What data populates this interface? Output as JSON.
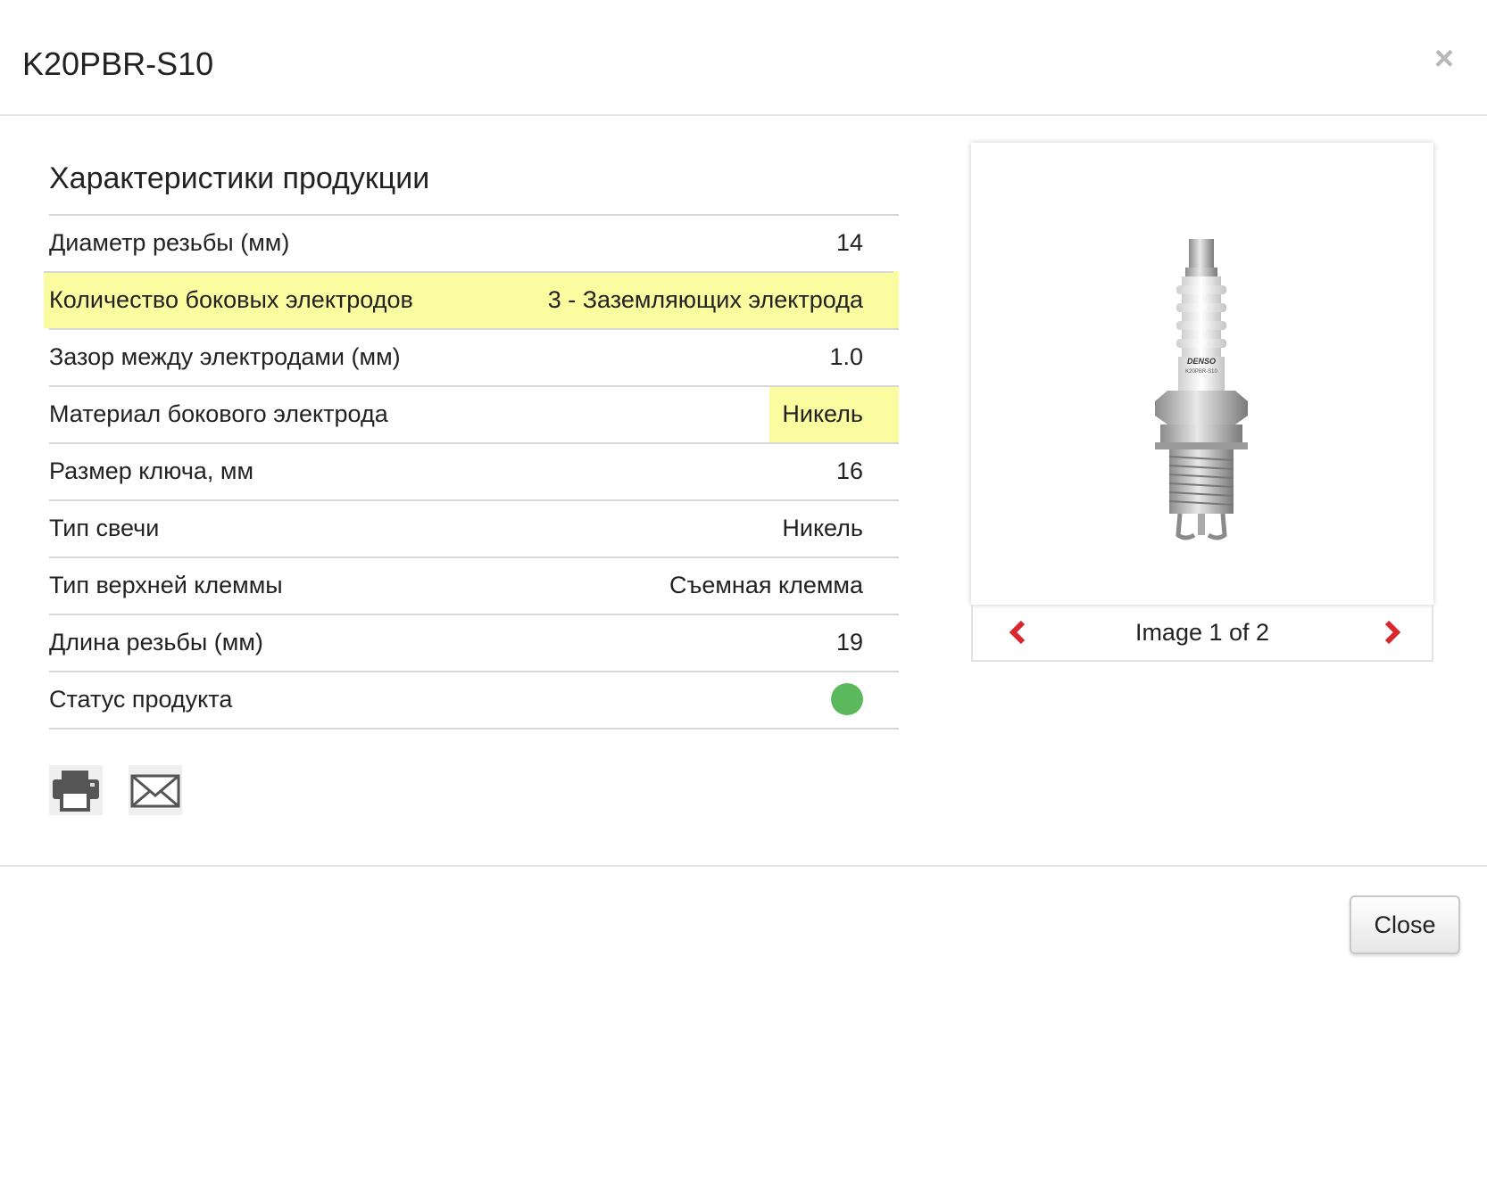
{
  "modal": {
    "title": "K20PBR-S10",
    "close_icon": "close-icon"
  },
  "specs": {
    "heading": "Характеристики продукции",
    "rows": [
      {
        "label": "Диаметр резьбы (мм)",
        "value": "14"
      },
      {
        "label": "Количество боковых электродов",
        "value": "3 - Заземляющих электрода"
      },
      {
        "label": "Зазор между электродами (мм)",
        "value": "1.0"
      },
      {
        "label": "Материал бокового электрода",
        "value": "Никель"
      },
      {
        "label": "Размер ключа, мм",
        "value": "16"
      },
      {
        "label": "Тип свечи",
        "value": "Никель"
      },
      {
        "label": "Тип верхней клеммы",
        "value": "Съемная клемма"
      },
      {
        "label": "Длина резьбы (мм)",
        "value": "19"
      },
      {
        "label": "Статус продукта",
        "value": ""
      }
    ],
    "highlight_color": "#fbfba0",
    "status_color": "#5cb85c"
  },
  "actions": {
    "print_icon": "printer-icon",
    "email_icon": "envelope-icon"
  },
  "gallery": {
    "product_image": "spark-plug-image",
    "image_text_brand": "DENSO",
    "image_text_model": "K20PBR-S10",
    "caption": "Image 1 of 2",
    "prev_icon": "chevron-left-icon",
    "next_icon": "chevron-right-icon",
    "arrow_color": "#d9272e"
  },
  "footer": {
    "close_label": "Close"
  }
}
